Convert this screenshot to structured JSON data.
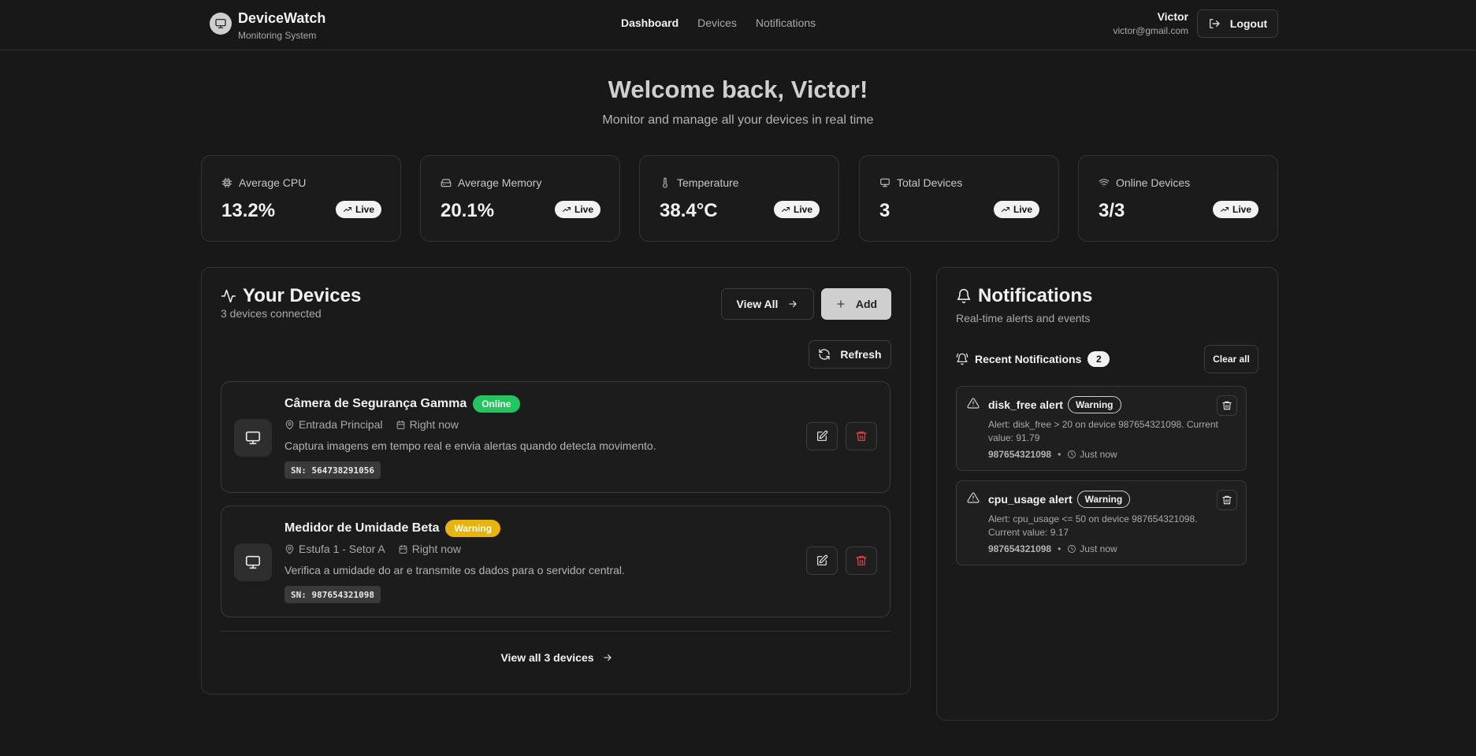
{
  "brand": {
    "name": "DeviceWatch",
    "subtitle": "Monitoring System",
    "icon": "monitor-icon"
  },
  "nav": {
    "items": [
      {
        "label": "Dashboard",
        "active": true
      },
      {
        "label": "Devices",
        "active": false
      },
      {
        "label": "Notifications",
        "active": false
      }
    ]
  },
  "user": {
    "name": "Victor",
    "email": "victor@gmail.com",
    "logout_label": "Logout"
  },
  "hero": {
    "title": "Welcome back, Victor!",
    "subtitle": "Monitor and manage all your devices in real time"
  },
  "stats": [
    {
      "label": "Average CPU",
      "value": "13.2%",
      "badge": "Live",
      "icon": "cpu-icon"
    },
    {
      "label": "Average Memory",
      "value": "20.1%",
      "badge": "Live",
      "icon": "hard-drive-icon"
    },
    {
      "label": "Temperature",
      "value": "38.4°C",
      "badge": "Live",
      "icon": "thermometer-icon"
    },
    {
      "label": "Total Devices",
      "value": "3",
      "badge": "Live",
      "icon": "monitor-icon"
    },
    {
      "label": "Online Devices",
      "value": "3/3",
      "badge": "Live",
      "icon": "wifi-icon"
    }
  ],
  "devices": {
    "title": "Your Devices",
    "count_text": "3 devices connected",
    "view_all_label": "View All",
    "add_label": "Add",
    "refresh_label": "Refresh",
    "items": [
      {
        "name": "Câmera de Segurança Gamma",
        "status": "Online",
        "location": "Entrada Principal",
        "time": "Right now",
        "description": "Captura imagens em tempo real e envia alertas quando detecta movimento.",
        "serial": "SN: 564738291056"
      },
      {
        "name": "Medidor de Umidade Beta",
        "status": "Warning",
        "location": "Estufa 1 - Setor A",
        "time": "Right now",
        "description": "Verifica a umidade do ar e transmite os dados para o servidor central.",
        "serial": "SN: 987654321098"
      }
    ],
    "view_all_devices_label": "View all 3 devices"
  },
  "notifications": {
    "title": "Notifications",
    "subtitle": "Real-time alerts and events",
    "recent_label": "Recent Notifications",
    "recent_count": "2",
    "clear_label": "Clear all",
    "items": [
      {
        "title": "disk_free alert",
        "level": "Warning",
        "message": "Alert: disk_free > 20 on device 987654321098. Current value: 91.79",
        "device": "987654321098",
        "time": "Just now"
      },
      {
        "title": "cpu_usage alert",
        "level": "Warning",
        "message": "Alert: cpu_usage <= 50 on device 987654321098. Current value: 9.17",
        "device": "987654321098",
        "time": "Just now"
      }
    ]
  },
  "colors": {
    "background": "#181818",
    "online": "#22c55e",
    "warning": "#eab308",
    "danger": "#ef4444"
  }
}
